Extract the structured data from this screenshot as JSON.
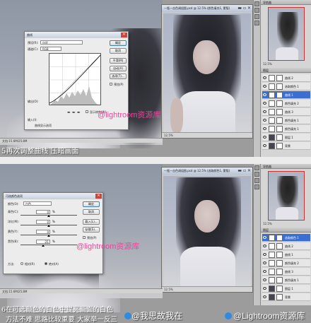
{
  "top": {
    "doc_title": "一瓶一击色调组图.psd @ 12.5% (颜色填充1, 蒙版)",
    "doc_zoom": "12.5%",
    "status_text": "文档:15.6M/25.8M",
    "curves": {
      "title": "曲线",
      "preset_label": "预设(R):",
      "preset_value": "自定",
      "channel_label": "通道(C):",
      "channel_value": "RGB",
      "output_label": "输出(O):",
      "input_label": "输入(I):",
      "show_clipping": "显示修剪(W)",
      "display_options": "曲线显示选项",
      "buttons": [
        "确定",
        "取消",
        "平滑(M)",
        "自动(A)",
        "选项(T)..."
      ],
      "preview_label": "预览(P)"
    },
    "caption": "5再次调整曲线 压暗画面",
    "watermark": "@lightroom资源库"
  },
  "bottom": {
    "doc_title": "一瓶一击色调组图.psd @ 12.5% (选取颜色1, 蒙版)",
    "doc_zoom": "12.5%",
    "status_text": "文档:15.6M/25.8M",
    "selective": {
      "title": "可选颜色选项",
      "color_label": "颜色(O):",
      "color_value": "白色",
      "rows": [
        {
          "label": "青色(C):",
          "value": "0"
        },
        {
          "label": "洋红(M):",
          "value": "0"
        },
        {
          "label": "黄色(Y):",
          "value": "0"
        },
        {
          "label": "黑色(B):",
          "value": "-21"
        }
      ],
      "method_label": "方法:",
      "relative_label": "相对(R)",
      "absolute_label": "绝对(A)",
      "buttons": [
        "确定",
        "取消",
        "载入(L)...",
        "存储(S)...",
        "预览(P)"
      ],
      "percent": "%"
    },
    "caption_line1": "6在可选颜色的白色中提亮画面的白色",
    "caption_line2": "方法不难 思路比较重要 大家举一反三",
    "watermark": "@lightroom资源库",
    "weibo_text": "@我思故我在",
    "weibo_right": "@Lightroom资源库"
  },
  "layers_top": [
    {
      "name": "曲线 2",
      "sel": false
    },
    {
      "name": "选取颜色 1",
      "sel": false
    },
    {
      "name": "曲线 1",
      "sel": true
    },
    {
      "name": "颜色填充 2",
      "sel": false
    },
    {
      "name": "曲线 3",
      "sel": false
    },
    {
      "name": "颜色填充 1",
      "sel": false
    },
    {
      "name": "颜色填充 1",
      "sel": false
    },
    {
      "name": "图层 1",
      "sel": false
    },
    {
      "name": "背景",
      "sel": false
    }
  ],
  "layers_bottom": [
    {
      "name": "选取颜色 1",
      "sel": true
    },
    {
      "name": "曲线 2",
      "sel": false
    },
    {
      "name": "曲线 1",
      "sel": false
    },
    {
      "name": "颜色填充 2",
      "sel": false
    },
    {
      "name": "曲线 3",
      "sel": false
    },
    {
      "name": "颜色填充 1",
      "sel": false
    },
    {
      "name": "图层 1",
      "sel": false
    },
    {
      "name": "背景",
      "sel": false
    }
  ],
  "panel_labels": {
    "navigator": "导航器",
    "layers": "图层",
    "nav_zoom": "12.5%"
  }
}
